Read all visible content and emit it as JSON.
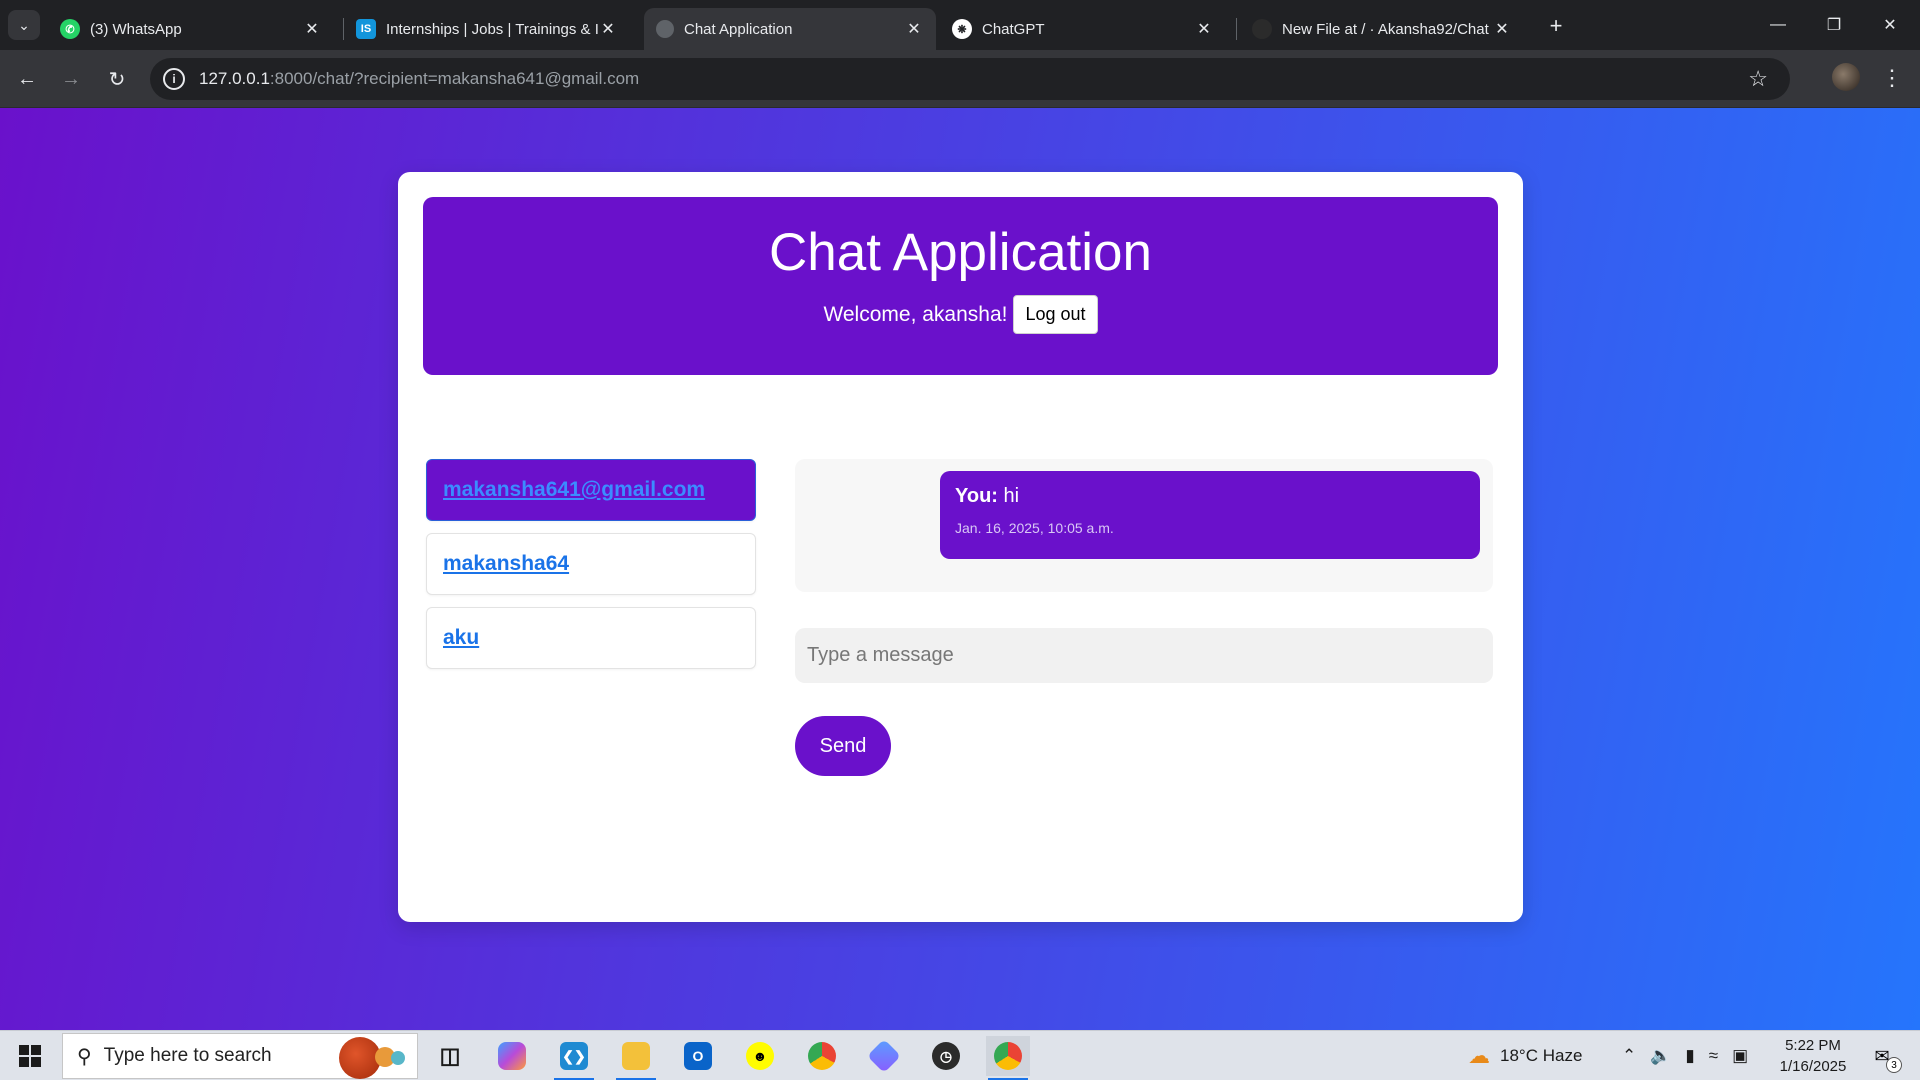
{
  "browser": {
    "tabs": [
      {
        "title": "(3) WhatsApp",
        "icon": "whatsapp-icon",
        "active": false
      },
      {
        "title": "Internships | Jobs | Trainings & I",
        "icon": "internshala-icon",
        "active": false
      },
      {
        "title": "Chat Application",
        "icon": "globe-icon",
        "active": true
      },
      {
        "title": "ChatGPT",
        "icon": "chatgpt-icon",
        "active": false
      },
      {
        "title": "New File at / · Akansha92/Chat",
        "icon": "github-icon",
        "active": false
      }
    ],
    "url_host": "127.0.0.1",
    "url_path": ":8000/chat/?recipient=makansha641@gmail.com"
  },
  "app": {
    "title": "Chat Application",
    "welcome": "Welcome, akansha!",
    "logout_label": "Log out",
    "accent_color": "#6a11cb",
    "gradient_end": "#2575fc"
  },
  "users": [
    {
      "name": "makansha641@gmail.com",
      "active": true
    },
    {
      "name": "makansha64",
      "active": false
    },
    {
      "name": "aku",
      "active": false
    }
  ],
  "messages": [
    {
      "sender": "You:",
      "text": "hi",
      "timestamp": "Jan. 16, 2025, 10:05 a.m."
    }
  ],
  "composer": {
    "placeholder": "Type a message",
    "send_label": "Send"
  },
  "taskbar": {
    "search_placeholder": "Type here to search",
    "weather": "18°C  Haze",
    "time": "5:22 PM",
    "date": "1/16/2025",
    "notification_count": "3"
  }
}
